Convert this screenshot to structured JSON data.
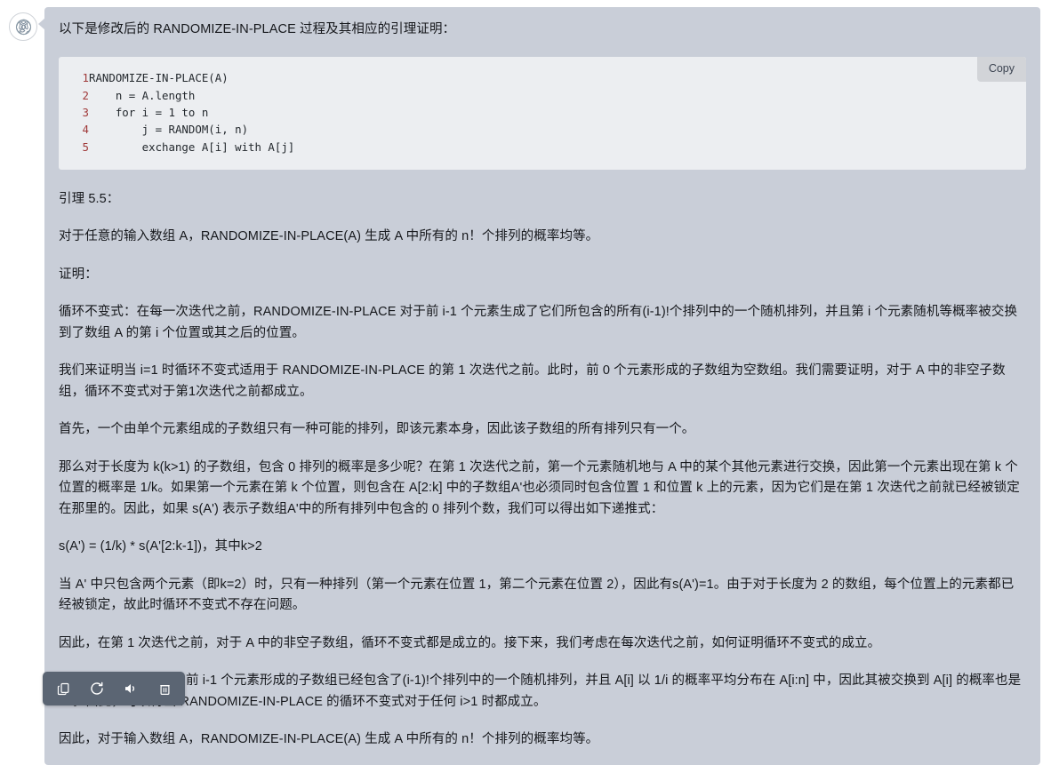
{
  "assistant": {
    "avatar_icon": "openai-logo-icon",
    "intro": "以下是修改后的 RANDOMIZE-IN-PLACE 过程及其相应的引理证明：",
    "code_block": {
      "copy_label": "Copy",
      "lines": [
        {
          "number": "1",
          "text": "RANDOMIZE-IN-PLACE(A)"
        },
        {
          "number": "2",
          "text": "    n = A.length"
        },
        {
          "number": "3",
          "text": "    for i = 1 to n"
        },
        {
          "number": "4",
          "text": "        j = RANDOM(i, n)"
        },
        {
          "number": "5",
          "text": "        exchange A[i] with A[j]"
        }
      ]
    },
    "paragraphs": [
      "引理 5.5：",
      "对于任意的输入数组 A，RANDOMIZE-IN-PLACE(A) 生成 A 中所有的 n！个排列的概率均等。",
      "证明：",
      "循环不变式：在每一次迭代之前，RANDOMIZE-IN-PLACE 对于前 i-1 个元素生成了它们所包含的所有(i-1)!个排列中的一个随机排列，并且第 i 个元素随机等概率被交换到了数组 A 的第 i 个位置或其之后的位置。",
      "我们来证明当 i=1 时循环不变式适用于 RANDOMIZE-IN-PLACE 的第 1 次迭代之前。此时，前 0 个元素形成的子数组为空数组。我们需要证明，对于 A 中的非空子数组，循环不变式对于第1次迭代之前都成立。",
      "首先，一个由单个元素组成的子数组只有一种可能的排列，即该元素本身，因此该子数组的所有排列只有一个。",
      "那么对于长度为 k(k>1) 的子数组，包含 0 排列的概率是多少呢？在第 1 次迭代之前，第一个元素随机地与 A 中的某个其他元素进行交换，因此第一个元素出现在第 k 个位置的概率是 1/k。如果第一个元素在第 k 个位置，则包含在 A[2:k] 中的子数组A'也必须同时包含位置 1 和位置 k 上的元素，因为它们是在第 1 次迭代之前就已经被锁定在那里的。因此，如果 s(A') 表示子数组A'中的所有排列中包含的 0 排列个数，我们可以得出如下递推式：",
      "s(A') = (1/k) * s(A'[2:k-1])，其中k>2",
      "当 A' 中只包含两个元素（即k=2）时，只有一种排列（第一个元素在位置 1，第二个元素在位置 2），因此有s(A')=1。由于对于长度为 2 的数组，每个位置上的元素都已经被锁定，故此时循环不变式不存在问题。",
      "因此，在第 1 次迭代之前，对于 A 中的非空子数组，循环不变式都是成立的。接下来，我们考虑在每次迭代之前，如何证明循环不变式的成立。",
      "对于第 i 次迭代之前，前 i-1 个元素形成的子数组已经包含了(i-1)!个排列中的一个随机排列，并且 A[i] 以 1/i 的概率平均分布在 A[i:n] 中，因此其被交换到 A[i] 的概率也是 1/i。由此，可以得出 RANDOMIZE-IN-PLACE 的循环不变式对于任何 i>1 时都成立。",
      "因此，对于输入数组 A，RANDOMIZE-IN-PLACE(A) 生成 A 中所有的 n！个排列的概率均等。"
    ]
  },
  "action_bar": {
    "buttons": [
      {
        "icon": "copy-icon",
        "label": "Copy"
      },
      {
        "icon": "regenerate-icon",
        "label": "Regenerate"
      },
      {
        "icon": "speaker-icon",
        "label": "Read aloud"
      },
      {
        "icon": "trash-icon",
        "label": "Delete"
      }
    ]
  },
  "colors": {
    "bubble_bg": "#c9ced8",
    "code_bg": "#eceef1",
    "action_bar_bg": "#5b6573",
    "line_number": "#a03a3a"
  }
}
